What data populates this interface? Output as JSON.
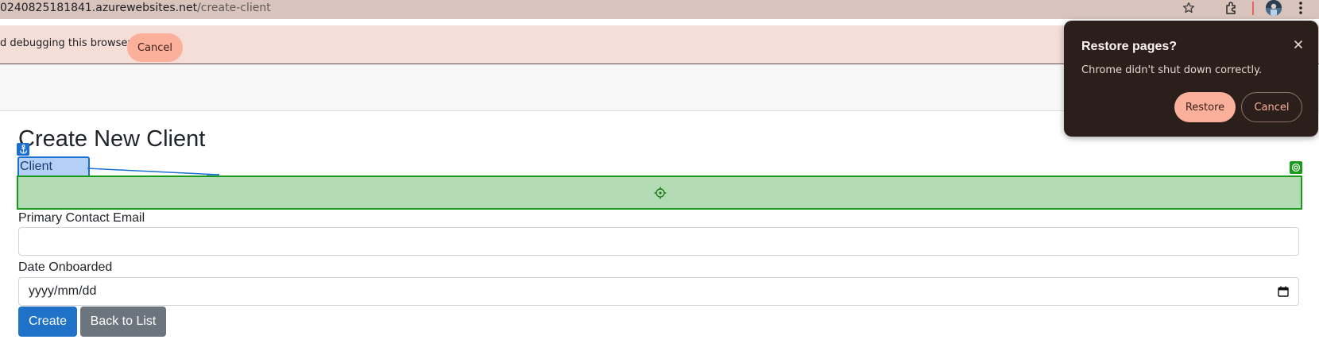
{
  "browser": {
    "url_host": "0240825181841.azurewebsites.net",
    "url_path": "/create-client",
    "icons": [
      "star-icon",
      "extensions-icon",
      "profile-avatar",
      "more-menu-icon"
    ]
  },
  "infobar": {
    "message": "d debugging this browser",
    "cancel_label": "Cancel"
  },
  "page": {
    "title": "Create New Client",
    "fields": {
      "client_name_label": "Client Name",
      "email_label": "Primary Contact Email",
      "date_label": "Date Onboarded",
      "date_placeholder": "yyyy/mm/dd"
    },
    "buttons": {
      "create": "Create",
      "back": "Back to List"
    }
  },
  "popup": {
    "title": "Restore pages?",
    "message": "Chrome didn't shut down correctly.",
    "restore_label": "Restore",
    "cancel_label": "Cancel"
  },
  "colors": {
    "primary_button": "#1f72c8",
    "secondary_button": "#6c757d",
    "popup_accent": "#fbb09c",
    "highlight_green": "#1a9a1a",
    "highlight_blue": "#1b6fd1"
  }
}
